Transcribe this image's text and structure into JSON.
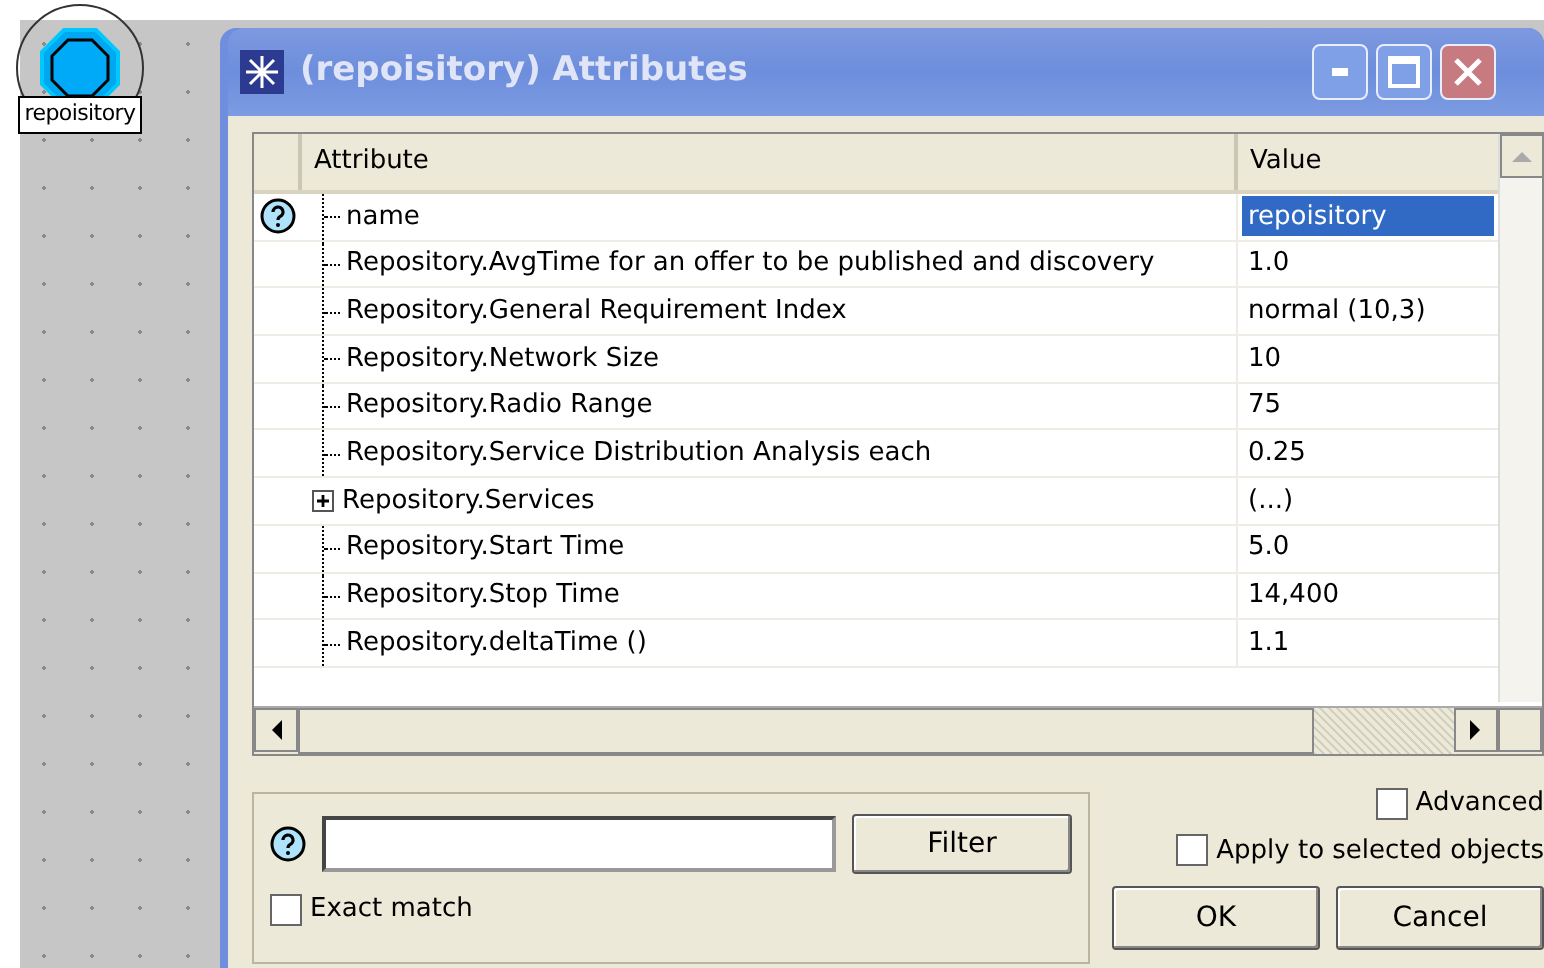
{
  "node": {
    "label": "repoisitory"
  },
  "dialog": {
    "title": "(repoisitory) Attributes",
    "columns": [
      "Attribute",
      "Value"
    ],
    "rows": [
      {
        "kind": "leaf",
        "help": true,
        "attribute": "name",
        "value": "repoisitory",
        "selected": true
      },
      {
        "kind": "leaf",
        "help": false,
        "attribute": "Repository.AvgTime for an offer to be published and discovery",
        "value": "1.0",
        "selected": false
      },
      {
        "kind": "leaf",
        "help": false,
        "attribute": "Repository.General Requirement Index",
        "value": "normal (10,3)",
        "selected": false
      },
      {
        "kind": "leaf",
        "help": false,
        "attribute": "Repository.Network Size",
        "value": "10",
        "selected": false
      },
      {
        "kind": "leaf",
        "help": false,
        "attribute": "Repository.Radio Range",
        "value": "75",
        "selected": false
      },
      {
        "kind": "leaf",
        "help": false,
        "attribute": "Repository.Service Distribution Analysis each",
        "value": "0.25",
        "selected": false
      },
      {
        "kind": "group",
        "help": false,
        "attribute": "Repository.Services",
        "value": "(...)",
        "selected": false
      },
      {
        "kind": "leaf",
        "help": false,
        "attribute": "Repository.Start Time",
        "value": "5.0",
        "selected": false
      },
      {
        "kind": "leaf",
        "help": false,
        "attribute": "Repository.Stop Time",
        "value": "14,400",
        "selected": false
      },
      {
        "kind": "leaf",
        "help": false,
        "attribute": "Repository.deltaTime ()",
        "value": "1.1",
        "selected": false
      }
    ],
    "filter": {
      "button": "Filter",
      "exact_match": {
        "label": "Exact match",
        "checked": false
      }
    },
    "advanced": {
      "label": "Advanced",
      "checked": false
    },
    "apply_to_selected": {
      "label": "Apply to selected objects",
      "checked": false
    },
    "buttons": [
      "OK",
      "Cancel"
    ]
  }
}
